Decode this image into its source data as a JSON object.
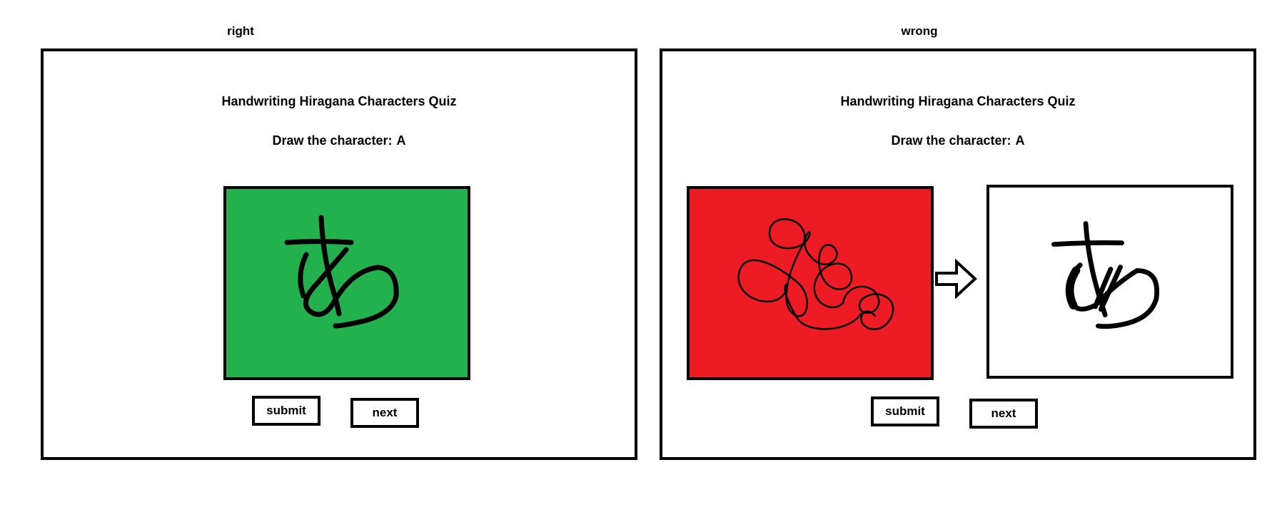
{
  "scenarios": {
    "right": {
      "label": "right",
      "title": "Handwriting Hiragana Characters Quiz",
      "prompt_label": "Draw the character:",
      "prompt_target": "A",
      "canvas_color": "#22b14c",
      "submit_label": "submit",
      "next_label": "next"
    },
    "wrong": {
      "label": "wrong",
      "title": "Handwriting Hiragana Characters Quiz",
      "prompt_label": "Draw the character:",
      "prompt_target": "A",
      "canvas_color": "#ed1c24",
      "answer_canvas_color": "#ffffff",
      "submit_label": "submit",
      "next_label": "next"
    }
  },
  "icons": {
    "arrow": "arrow-right-icon"
  }
}
